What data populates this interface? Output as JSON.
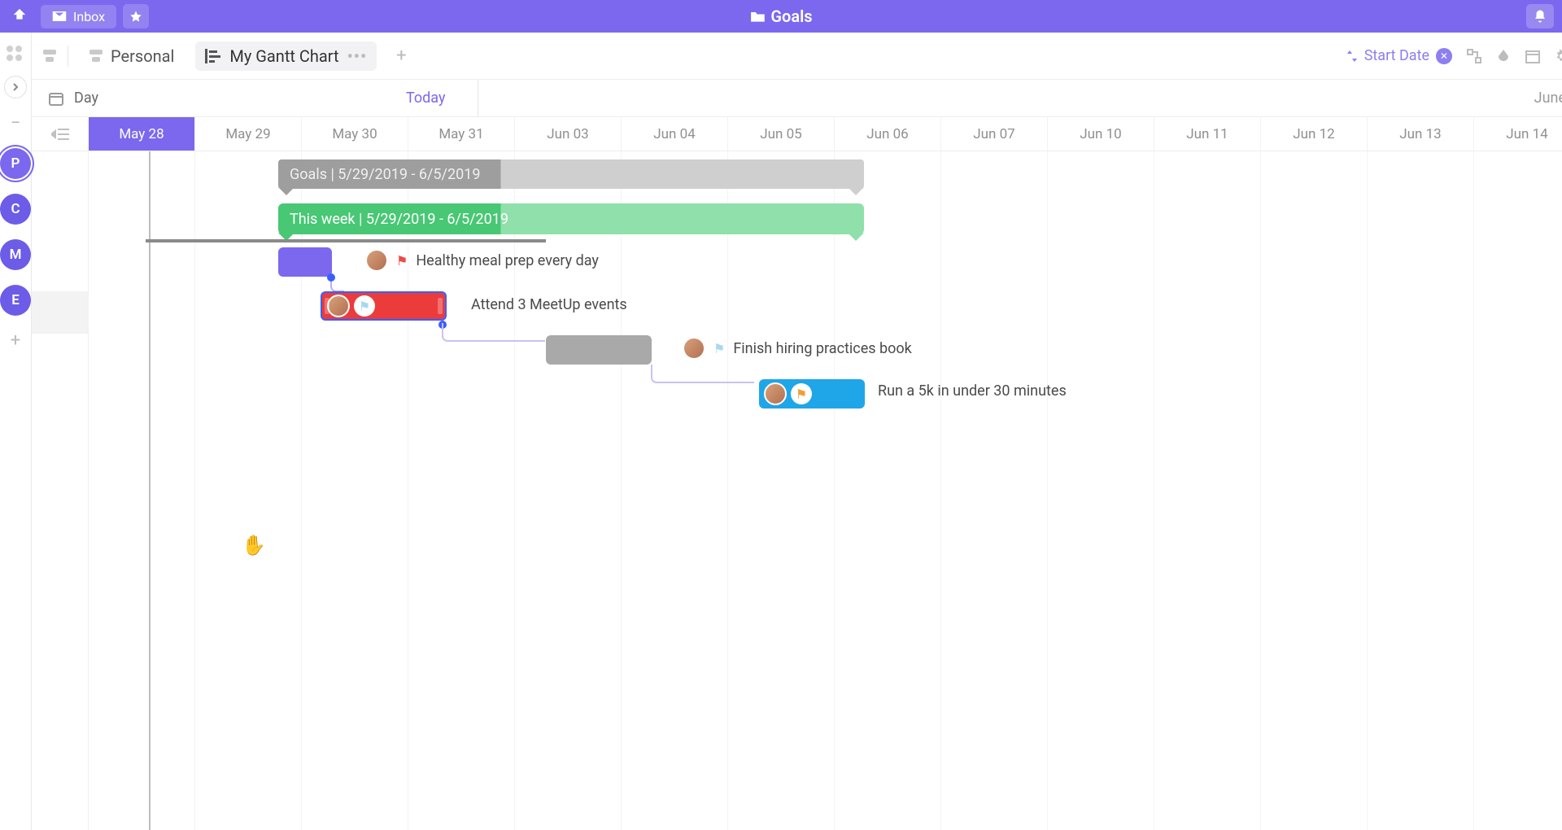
{
  "topbar": {
    "inbox_label": "Inbox",
    "title": "Goals"
  },
  "viewbar": {
    "personal_label": "Personal",
    "current_view_label": "My Gantt Chart",
    "start_date_label": "Start Date"
  },
  "daybar": {
    "scale_label": "Day",
    "today_label": "Today",
    "month_label": "June"
  },
  "dates": [
    "May 28",
    "May 29",
    "May 30",
    "May 31",
    "Jun 03",
    "Jun 04",
    "Jun 05",
    "Jun 06",
    "Jun 07",
    "Jun 10",
    "Jun 11",
    "Jun 12",
    "Jun 13",
    "Jun 14"
  ],
  "summary_bars": [
    {
      "label": "Goals | 5/29/2019 - 6/5/2019"
    },
    {
      "label": "This week | 5/29/2019 - 6/5/2019"
    }
  ],
  "tasks": [
    {
      "label": "Healthy meal prep every day",
      "flag": "red"
    },
    {
      "label": "Attend 3 MeetUp events",
      "flag": "lblue"
    },
    {
      "label": "Finish hiring practices book",
      "flag": "lblue"
    },
    {
      "label": "Run a 5k in under 30 minutes",
      "flag": "orange"
    }
  ],
  "sidebar_spaces": [
    {
      "letter": "P",
      "color": "#7b68ee",
      "selected": true
    },
    {
      "letter": "C",
      "color": "#6c5ce7",
      "selected": false
    },
    {
      "letter": "M",
      "color": "#6c5ce7",
      "selected": false
    },
    {
      "letter": "E",
      "color": "#6c5ce7",
      "selected": false
    }
  ]
}
